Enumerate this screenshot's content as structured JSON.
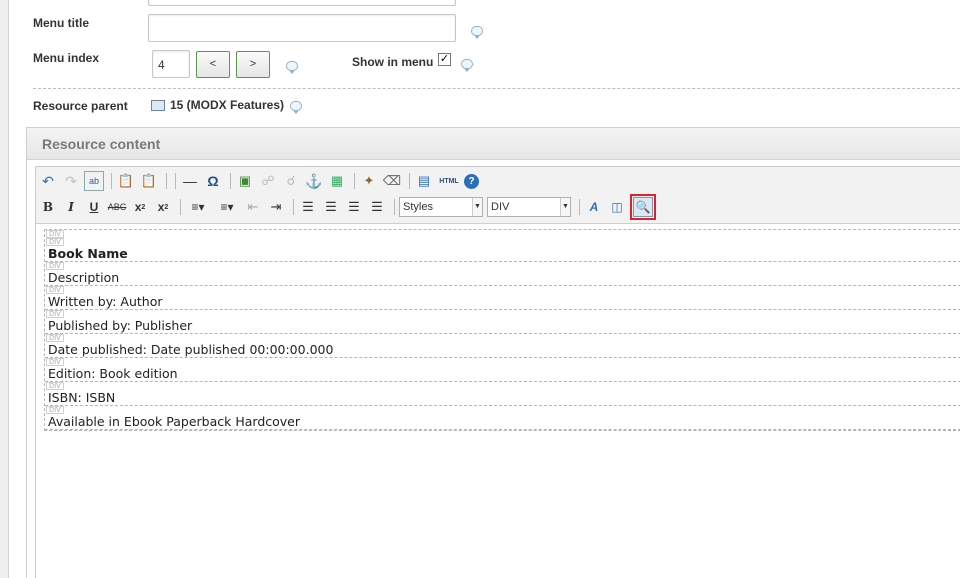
{
  "form": {
    "menu_title_label": "Menu title",
    "menu_index_label": "Menu index",
    "menu_index_value": "4",
    "prev_label": "<",
    "next_label": ">",
    "show_in_menu_label": "Show in menu",
    "show_in_menu_checked": true,
    "resource_parent_label": "Resource parent",
    "resource_parent_value": "15 (MODX Features)"
  },
  "panel": {
    "title": "Resource content"
  },
  "toolbar": {
    "styles_value": "Styles",
    "format_value": "DIV",
    "html_label": "HTML"
  },
  "content": {
    "div_tag": "DIV",
    "lines": [
      "Book Name",
      "Description",
      "Written by: Author",
      "Published by: Publisher",
      "Date published: Date published 00:00:00.000",
      "Edition: Book edition",
      "ISBN: ISBN",
      "Available in Ebook Paperback Hardcover"
    ]
  }
}
